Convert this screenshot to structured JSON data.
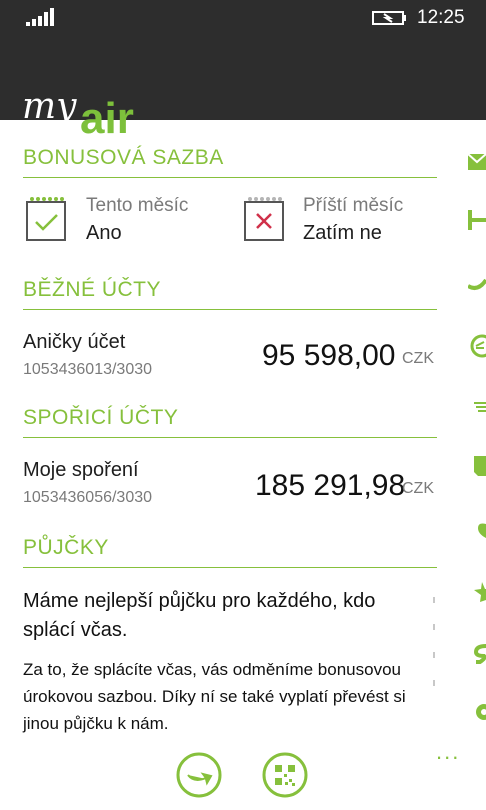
{
  "statusbar": {
    "time": "12:25",
    "signal_icon": "signal-bars-icon",
    "battery_icon": "battery-charging-icon"
  },
  "app": {
    "logo_prefix": "my",
    "logo_main": "air",
    "accent_color": "#86c03c",
    "header_color": "#2d2d2d"
  },
  "bonus": {
    "title": "BONUSOVÁ SAZBA",
    "this_month": {
      "label": "Tento měsíc",
      "value": "Ano",
      "icon": "calendar-check-icon"
    },
    "next_month": {
      "label": "Příští měsíc",
      "value": "Zatím ne",
      "icon": "calendar-cross-icon"
    }
  },
  "current_accounts": {
    "title": "BĚŽNÉ ÚČTY",
    "items": [
      {
        "name": "Aničky účet",
        "number": "1053436013/3030",
        "amount": "95 598,00",
        "currency": "CZK"
      }
    ]
  },
  "savings_accounts": {
    "title": "SPOŘICÍ ÚČTY",
    "items": [
      {
        "name": "Moje spoření",
        "number": "1053436056/3030",
        "amount": "185 291,98",
        "currency": "CZK"
      }
    ]
  },
  "loans": {
    "title": "PŮJČKY",
    "lead": "Máme nejlepší půjčku pro každého, kdo splácí včas.",
    "body": "Za to, že splácíte včas, vás odměníme bonusovou úrokovou sazbou. Díky ní se také vyplatí převést si jinou půjčku k nám."
  },
  "bottom_actions": [
    {
      "icon": "transfer-arrow-icon"
    },
    {
      "icon": "qr-code-icon"
    }
  ],
  "side_menu": {
    "icons": [
      "envelope-icon",
      "transfer-icon",
      "phone-icon",
      "money-icon",
      "list-icon",
      "document-icon",
      "heart-icon",
      "star-icon",
      "dollar-icon",
      "gear-icon"
    ],
    "more": "..."
  }
}
